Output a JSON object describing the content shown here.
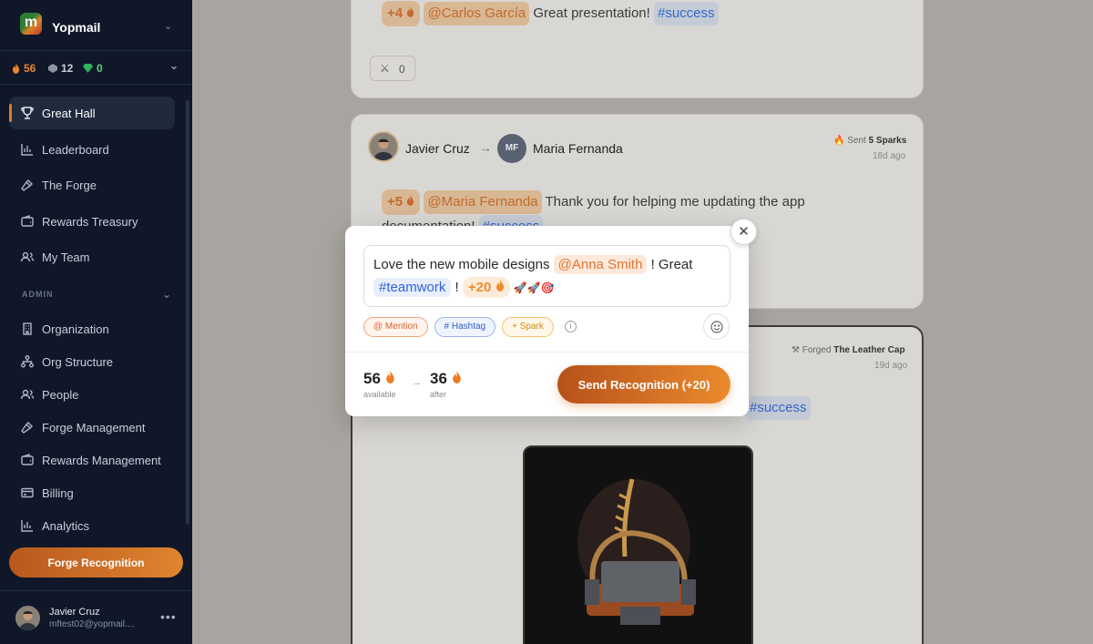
{
  "workspace": {
    "name": "Yopmail",
    "logo_letter": "m"
  },
  "stats": {
    "sparks": "56",
    "gems_gray": "12",
    "gems_green": "0"
  },
  "nav": {
    "items": [
      {
        "label": "Great Hall"
      },
      {
        "label": "Leaderboard"
      },
      {
        "label": "The Forge"
      },
      {
        "label": "Rewards Treasury"
      },
      {
        "label": "My Team"
      }
    ],
    "admin_heading": "ADMIN",
    "admin_items": [
      {
        "label": "Organization"
      },
      {
        "label": "Org Structure"
      },
      {
        "label": "People"
      },
      {
        "label": "Forge Management"
      },
      {
        "label": "Rewards Management"
      },
      {
        "label": "Billing"
      },
      {
        "label": "Analytics"
      }
    ],
    "forge_button": "Forge Recognition"
  },
  "user": {
    "name": "Javier Cruz",
    "email": "mftest02@yopmail...."
  },
  "feed": {
    "card1": {
      "spark": "+4",
      "mention": "@Carlos García",
      "text": "Great presentation!",
      "hashtag": "#success",
      "reaction_count": "0"
    },
    "card2": {
      "sender": "Javier Cruz",
      "recipient": "Maria Fernanda",
      "recipient_initials": "MF",
      "meta_prefix": "Sent",
      "meta_value": "5 Sparks",
      "ago": "18d ago",
      "spark": "+5",
      "mention": "@Maria Fernanda",
      "text": "Thank you for helping me updating the app documentation!",
      "hashtag": "#success"
    },
    "card3": {
      "meta_prefix": "Forged",
      "meta_value": "The Leather Cap",
      "ago": "19d ago",
      "hashtag": "#success"
    }
  },
  "modal": {
    "text_before": "Love the new mobile designs",
    "mention": "@Anna Smith",
    "text_mid": "! Great",
    "hashtag": "#teamwork",
    "text_bang": "!",
    "spark": "+20",
    "emojis": "🚀🚀🎯",
    "tool_mention": "@ Mention",
    "tool_hashtag": "# Hashtag",
    "tool_spark": "+ Spark",
    "available_value": "56",
    "available_label": "available",
    "after_value": "36",
    "after_label": "after",
    "send_label": "Send Recognition (+20)"
  },
  "colors": {
    "accent": "#e07a2b",
    "sidebar_bg": "#0f1729",
    "hashtag": "#2f63d8"
  }
}
